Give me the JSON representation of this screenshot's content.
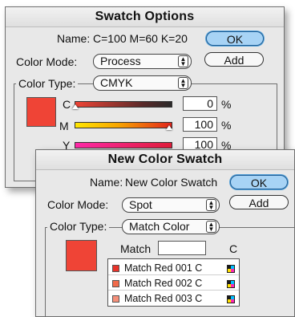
{
  "swatch_options": {
    "title": "Swatch Options",
    "name_label": "Name:",
    "name_value": "C=100 M=60 K=20",
    "ok_label": "OK",
    "add_label": "Add",
    "color_mode_label": "Color Mode:",
    "color_mode_value": "Process",
    "color_type_label": "Color Type:",
    "color_type_value": "CMYK",
    "swatch_color": "#ef4436",
    "channels": [
      {
        "label": "C",
        "value": "0",
        "unit": "%"
      },
      {
        "label": "M",
        "value": "100",
        "unit": "%"
      },
      {
        "label": "Y",
        "value": "100",
        "unit": "%"
      }
    ]
  },
  "new_color_swatch": {
    "title": "New Color Swatch",
    "name_label": "Name:",
    "name_value": "New Color Swatch",
    "ok_label": "OK",
    "add_label": "Add",
    "color_mode_label": "Color Mode:",
    "color_mode_value": "Spot",
    "color_type_label": "Color Type:",
    "color_type_value": "Match Color",
    "swatch_color": "#ef4436",
    "match_label": "Match",
    "match_value": "",
    "match_suffix": "C",
    "match_list": [
      {
        "label": "Match Red 001 C",
        "color": "#e8332a"
      },
      {
        "label": "Match Red 002 C",
        "color": "#f06a4a"
      },
      {
        "label": "Match Red 003 C",
        "color": "#f5907a"
      }
    ]
  },
  "icons": {
    "select_arrows": "up-down-arrows-icon",
    "mode_icon": "cmyk-mode-icon"
  }
}
